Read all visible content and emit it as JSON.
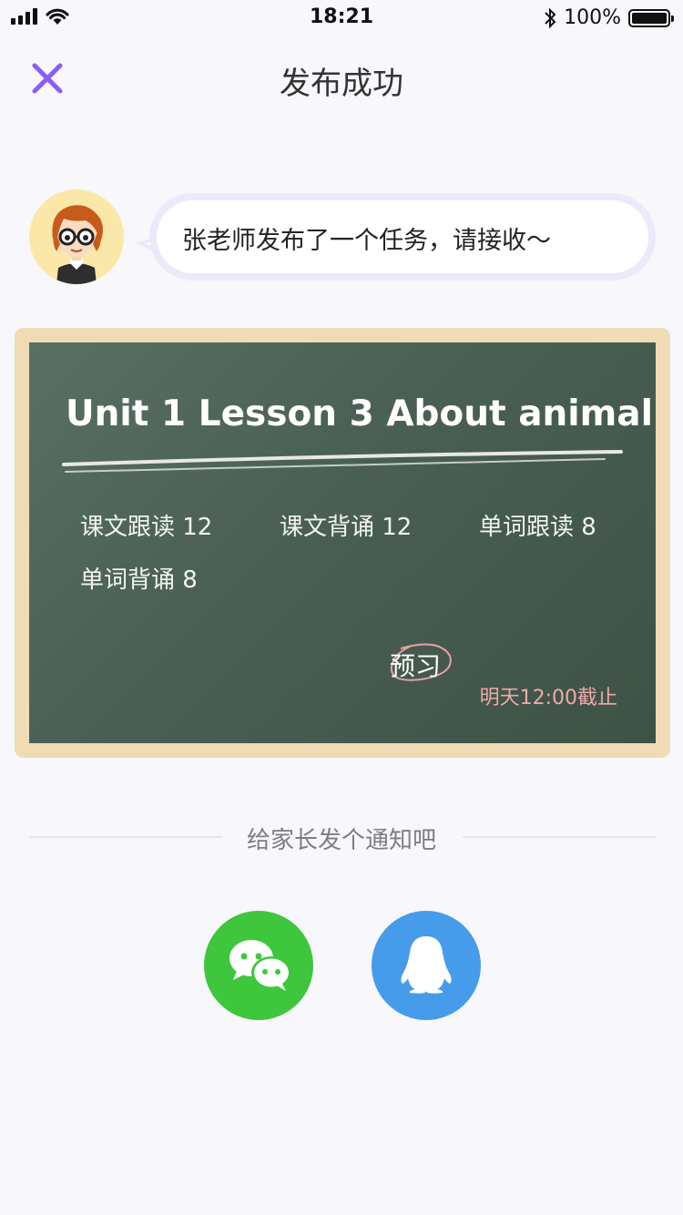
{
  "status_bar": {
    "time": "18:21",
    "battery": "100%"
  },
  "nav": {
    "title": "发布成功"
  },
  "message": {
    "text": "张老师发布了一个任务，请接收～"
  },
  "task_card": {
    "title": "Unit 1 Lesson 3 About animal",
    "items": [
      "课文跟读 12",
      "课文背诵 12",
      "单词跟读 8",
      "单词背诵 8"
    ],
    "tag": "预习",
    "deadline": "明天12:00截止"
  },
  "share": {
    "prompt": "给家长发个通知吧",
    "buttons": [
      {
        "icon": "wechat-icon",
        "color": "#3ec63c"
      },
      {
        "icon": "qq-icon",
        "color": "#469cea"
      }
    ]
  },
  "colors": {
    "accent": "#8b5cf6",
    "board": "#4a5f54",
    "frame": "#efdbb4"
  }
}
